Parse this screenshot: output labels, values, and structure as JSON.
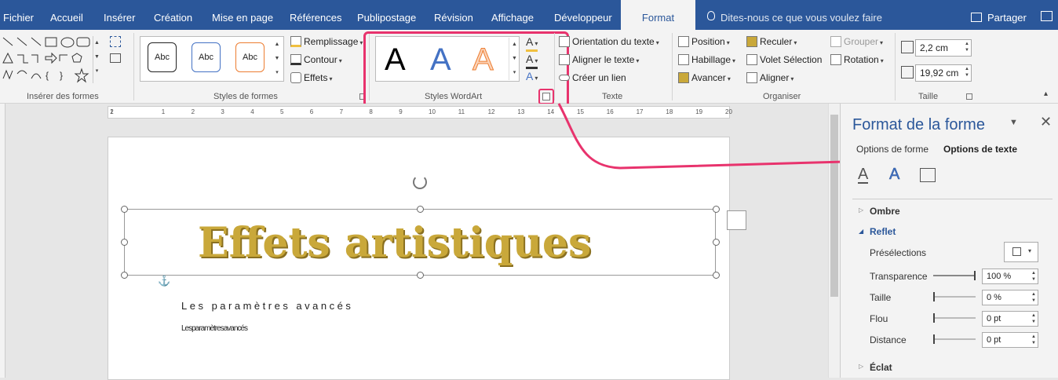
{
  "menu": {
    "tabs": [
      "Fichier",
      "Accueil",
      "Insérer",
      "Création",
      "Mise en page",
      "Références",
      "Publipostage",
      "Révision",
      "Affichage",
      "Développeur",
      "Format"
    ],
    "tell_me": "Dites-nous ce que vous voulez faire",
    "share": "Partager"
  },
  "ribbon": {
    "groups": {
      "insert_shapes": "Insérer des formes",
      "shape_styles": "Styles de formes",
      "wordart_styles": "Styles WordArt",
      "text": "Texte",
      "arrange": "Organiser",
      "size": "Taille"
    },
    "shape_style_samples": [
      "Abc",
      "Abc",
      "Abc"
    ],
    "fill": "Remplissage",
    "outline": "Contour",
    "effects": "Effets",
    "wordart_samples": [
      "A",
      "A",
      "A"
    ],
    "text_direction": "Orientation du texte",
    "align_text": "Aligner le texte",
    "create_link": "Créer un lien",
    "position": "Position",
    "wrap_text": "Habillage",
    "bring_forward": "Avancer",
    "send_backward": "Reculer",
    "selection_pane": "Volet Sélection",
    "align": "Aligner",
    "group": "Grouper",
    "rotate": "Rotation",
    "height": "2,2 cm",
    "width": "19,92 cm"
  },
  "ruler": {
    "numbers": [
      "1",
      "2",
      "1",
      "2",
      "3",
      "4",
      "5",
      "6",
      "7",
      "8",
      "9",
      "10",
      "11",
      "12",
      "13",
      "14",
      "15",
      "16",
      "17",
      "18",
      "19",
      "20"
    ]
  },
  "document": {
    "wordart_text": "Effets artistiques",
    "line1": "Les paramètres avancés",
    "line2": "Lesparamètresavancés"
  },
  "pane": {
    "title": "Format de la forme",
    "tab_shape": "Options de forme",
    "tab_text": "Options de texte",
    "shadow": "Ombre",
    "reflection": "Reflet",
    "presets": "Présélections",
    "transparency": "Transparence",
    "transparency_value": "100 %",
    "size": "Taille",
    "size_value": "0 %",
    "blur": "Flou",
    "blur_value": "0 pt",
    "distance": "Distance",
    "distance_value": "0 pt",
    "glow": "Éclat"
  },
  "colors": {
    "accent": "#2b579a",
    "highlight": "#e8336d",
    "wordart_gold": "#c9a83a"
  }
}
